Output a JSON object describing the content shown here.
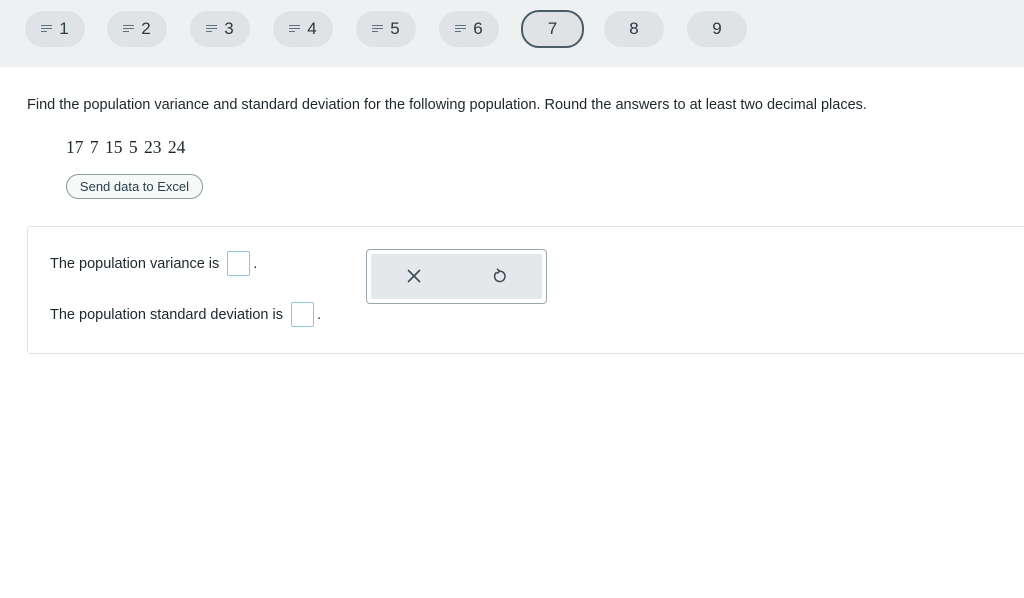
{
  "question_nav": {
    "items": [
      {
        "number": "1",
        "status": "answered"
      },
      {
        "number": "2",
        "status": "answered"
      },
      {
        "number": "3",
        "status": "answered"
      },
      {
        "number": "4",
        "status": "answered"
      },
      {
        "number": "5",
        "status": "answered"
      },
      {
        "number": "6",
        "status": "answered"
      },
      {
        "number": "7",
        "status": "current"
      },
      {
        "number": "8",
        "status": "unanswered"
      },
      {
        "number": "9",
        "status": "unanswered"
      }
    ],
    "answered_icon": "answered-lines-icon"
  },
  "problem": {
    "prompt": "Find the population variance and standard deviation for the following population. Round the answers to at least two decimal places.",
    "data": "17 7 15 5 23 24",
    "excel_button_label": "Send data to Excel"
  },
  "answers": {
    "variance_label": "The population variance is",
    "variance_value": "",
    "std_label": "The population standard deviation is",
    "std_value": "",
    "period": "."
  },
  "tools": {
    "clear_icon": "close-icon",
    "undo_icon": "undo-icon"
  },
  "colors": {
    "topbar_bg": "#eef1f2",
    "pill_bg": "#dfe3e5",
    "current_border": "#4b5c64",
    "input_border": "#8dc6dd"
  }
}
